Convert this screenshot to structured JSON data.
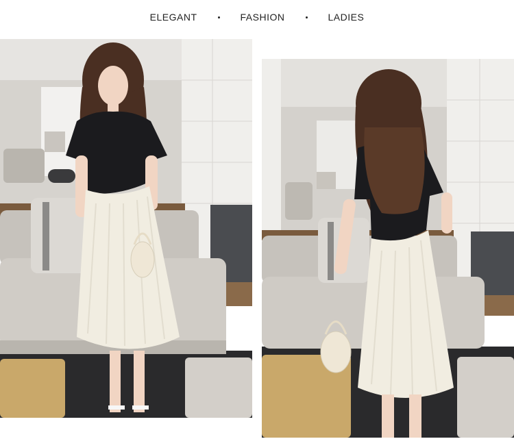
{
  "header": {
    "words": [
      "ELEGANT",
      "FASHION",
      "LADIES"
    ]
  },
  "photos": [
    {
      "subject": "front view",
      "bg": "#d9d6d1"
    },
    {
      "subject": "back view",
      "bg": "#d7d4cf"
    }
  ],
  "colors": {
    "top": "#1b1b1e",
    "skirt": "#f1ede1",
    "sofa": "#c6c2bc",
    "wall": "#ecebe8",
    "floor_dark": "#2a2a2c",
    "wood": "#8a6a4a"
  }
}
